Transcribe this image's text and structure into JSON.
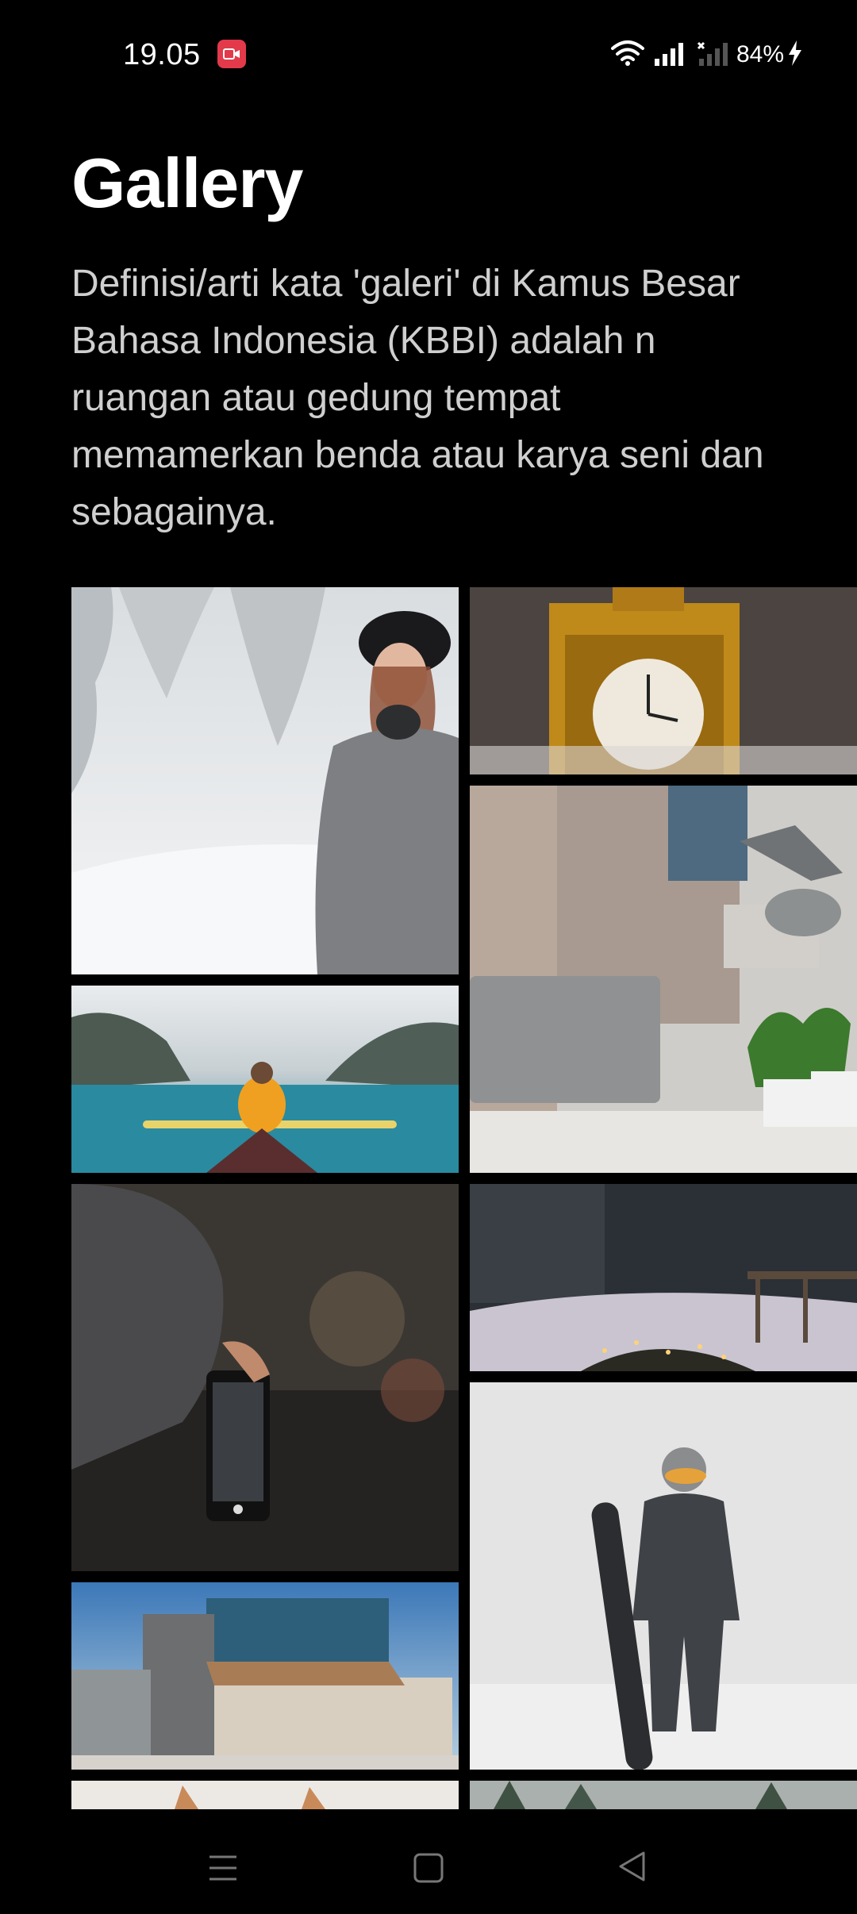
{
  "status_bar": {
    "time": "19.05",
    "battery": "84%",
    "icons": [
      "screen-record-icon",
      "wifi-icon",
      "signal-icon",
      "signal-no-sim-icon",
      "charging-bolt-icon"
    ]
  },
  "header": {
    "title": "Gallery",
    "description": "Definisi/arti kata 'galeri' di Kamus Besar Bahasa Indonesia (KBBI) adalah n ruangan atau gedung tempat memamerkan benda atau karya seni dan sebagainya."
  },
  "gallery": {
    "columns": 2,
    "left_column": [
      "woman-in-snowy-forest-photo",
      "kayak-in-fjord-photo",
      "phone-camera-photography-photo",
      "modern-building-photo",
      "cat-photo"
    ],
    "right_column": [
      "golden-clock-photo",
      "laptop-desk-window-photo",
      "snowy-street-lights-photo",
      "snowboarder-in-snow-photo",
      "winter-trees-photo"
    ]
  },
  "nav_bar": {
    "icons": [
      "menu-icon",
      "home-icon",
      "back-icon"
    ]
  }
}
